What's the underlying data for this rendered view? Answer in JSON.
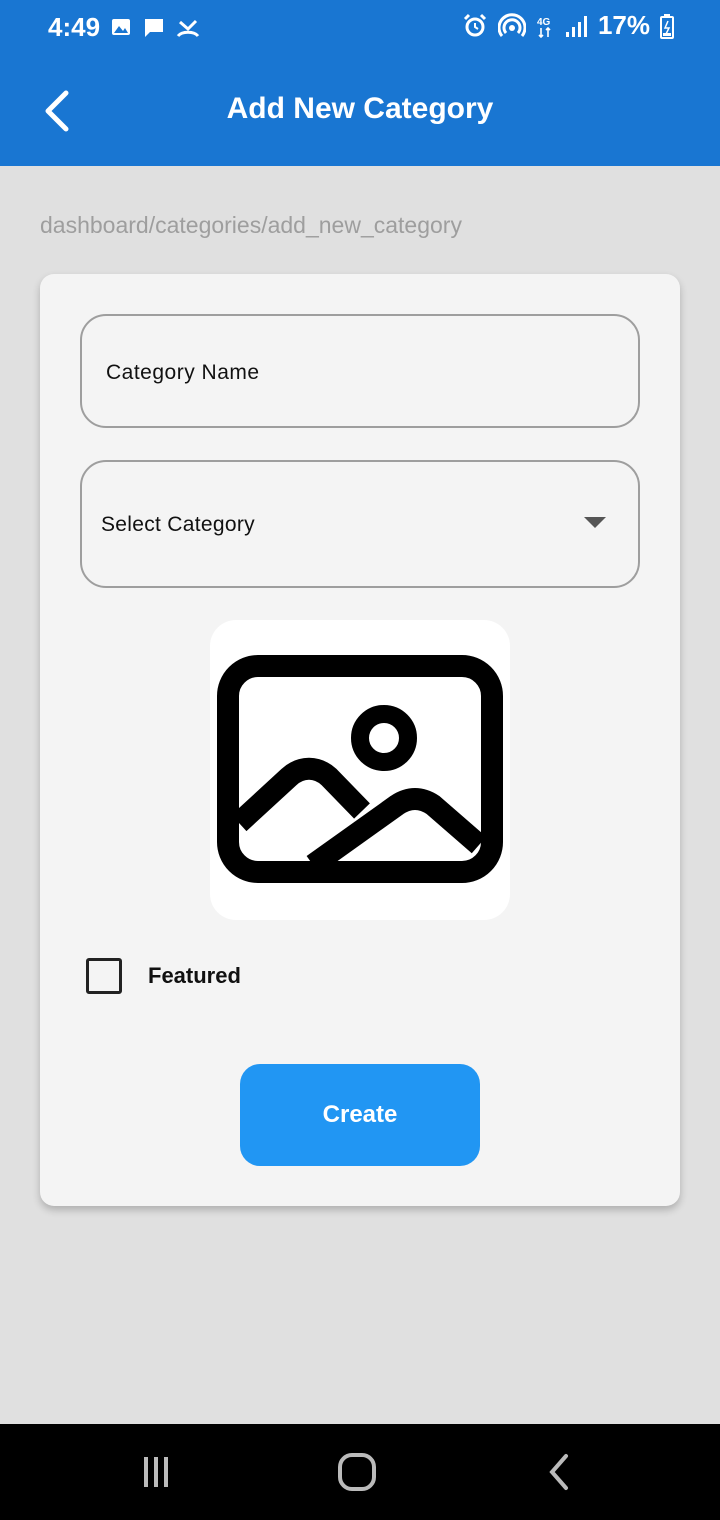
{
  "status_bar": {
    "time": "4:49",
    "battery": "17%",
    "left_icons": [
      "image-icon",
      "chat-icon",
      "missed-call-icon"
    ],
    "right_icons": [
      "alarm-icon",
      "hotspot-icon",
      "4g-icon",
      "signal-icon",
      "battery-icon"
    ]
  },
  "app_bar": {
    "title": "Add New Category",
    "back_icon": "back-arrow-icon",
    "color": "#1976d2"
  },
  "breadcrumb": "dashboard/categories/add_new_category",
  "form": {
    "category_name_placeholder": "Category Name",
    "select_category_placeholder": "Select Category",
    "image_placeholder_icon": "image-icon",
    "featured_label": "Featured",
    "featured_checked": false,
    "create_label": "Create",
    "accent_color": "#2196f3"
  },
  "nav_bar": {
    "icons": [
      "recents-icon",
      "home-icon",
      "back-icon"
    ]
  }
}
